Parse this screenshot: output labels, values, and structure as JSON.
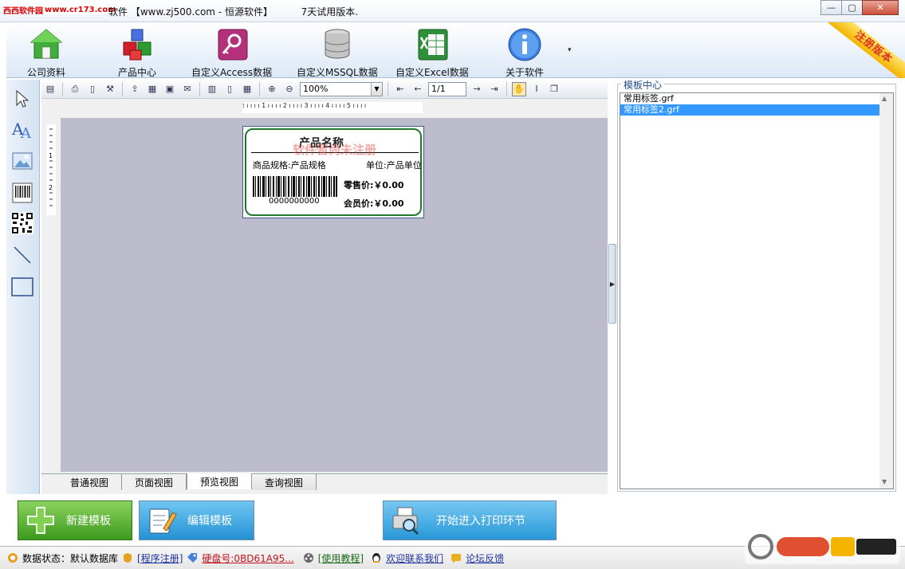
{
  "window": {
    "logo_text_a": "西西软件园",
    "logo_text_b": "www.cr173.com",
    "title_partial": "软件",
    "title_site": "【www.zj500.com - 恒源软件】",
    "title_trial": "7天试用版本.",
    "min_glyph": "—",
    "max_glyph": "▢",
    "close_glyph": "✕"
  },
  "toolbar": {
    "items": [
      {
        "label": "公司资料",
        "icon": "house-icon"
      },
      {
        "label": "产品中心",
        "icon": "cubes-icon"
      },
      {
        "label": "自定义Access数据",
        "icon": "access-key-icon"
      },
      {
        "label": "自定义MSSQL数据",
        "icon": "database-icon"
      },
      {
        "label": "自定义Excel数据",
        "icon": "excel-icon"
      },
      {
        "label": "关于软件",
        "icon": "info-icon"
      }
    ],
    "more_glyph": "▾",
    "ribbon_text": "注册版本"
  },
  "editor": {
    "zoom": "100%",
    "page": "1/1",
    "ruler_text": "⁞ ı ı ı ı 1 ı ı ı ı 2 ı ı ı ı 3 ı ı ı ı 4 ı ı ı ı 5 ı ı ı ı"
  },
  "label": {
    "product_name": "产品名称",
    "overlay": "软件暂尚未注册",
    "spec": "商品规格:产品规格",
    "unit": "单位:产品单位",
    "barcode_number": "0000000000",
    "retail_price": "零售价:￥0.00",
    "member_price": "会员价:￥0.00"
  },
  "view_tabs": [
    "普通视图",
    "页面视图",
    "预览视图",
    "查询视图"
  ],
  "template_center": {
    "title": "模板中心",
    "items": [
      "常用标签.grf",
      "常用标签2.grf"
    ],
    "selected_index": 1
  },
  "buttons": {
    "new_template": "新建模板",
    "edit_template": "编辑模板",
    "start_print": "开始进入打印环节"
  },
  "status": {
    "db_status": "数据状态：默认数据库",
    "register": "[程序注册]",
    "disk": "硬盘号:0BD61A95...",
    "tutorial": "[使用教程]",
    "contact": "欢迎联系我们",
    "forum": "论坛反馈"
  },
  "colors": {
    "accent_blue": "#3399ff",
    "label_border_green": "#1f7a2e",
    "new_button_green": "#3c9a1e",
    "ribbon_red": "#e0311c"
  }
}
